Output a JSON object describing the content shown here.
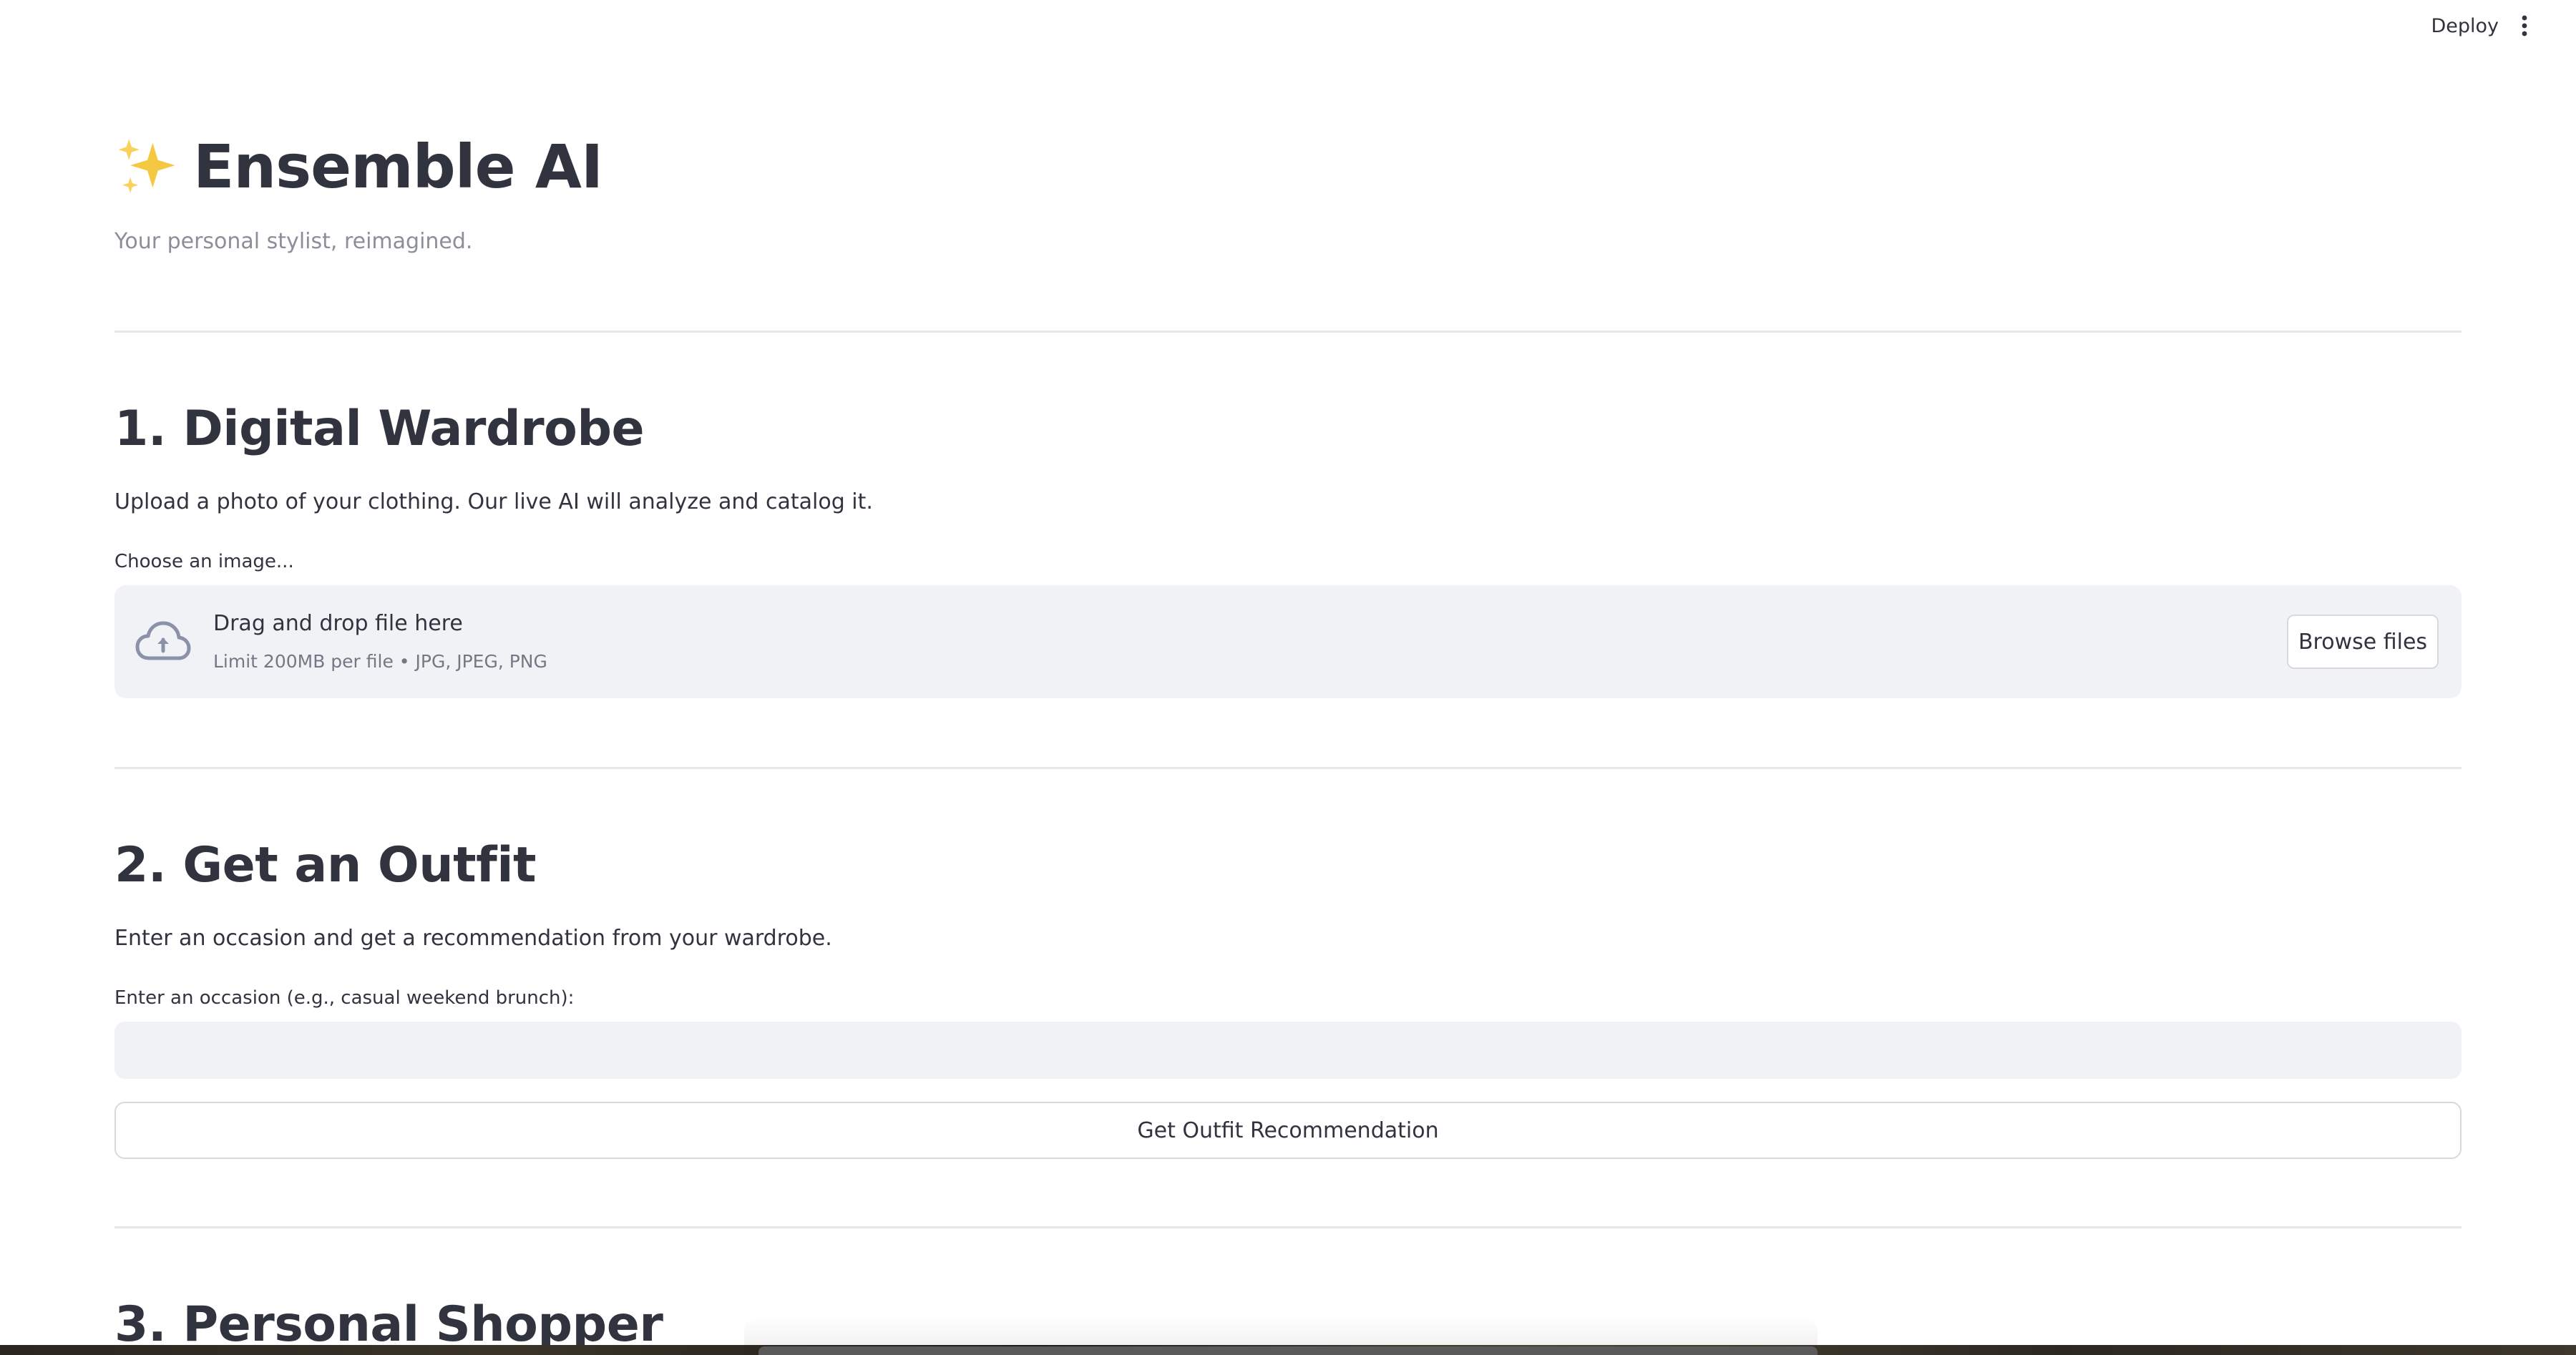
{
  "header": {
    "deploy_label": "Deploy",
    "menu_icon": "vertical-ellipsis-icon"
  },
  "app": {
    "title_icon": "sparkles-icon",
    "title": "Ensemble AI",
    "subtitle": "Your personal stylist, reimagined."
  },
  "wardrobe": {
    "heading": "1. Digital Wardrobe",
    "description": "Upload a photo of your clothing. Our live AI will analyze and catalog it.",
    "uploader_label": "Choose an image...",
    "dropzone_icon": "cloud-upload-icon",
    "dropzone_title": "Drag and drop file here",
    "dropzone_limit": "Limit 200MB per file • JPG, JPEG, PNG",
    "browse_label": "Browse files"
  },
  "outfit": {
    "heading": "2. Get an Outfit",
    "description": "Enter an occasion and get a recommendation from your wardrobe.",
    "input_label": "Enter an occasion (e.g., casual weekend brunch):",
    "input_value": "",
    "button_label": "Get Outfit Recommendation"
  },
  "shopper": {
    "heading": "3. Personal Shopper"
  },
  "colors": {
    "text": "#31333f",
    "muted": "#8c8f99",
    "input_bg": "#f0f2f6",
    "border": "#d8d9de",
    "sparkle": "#f5c842"
  }
}
